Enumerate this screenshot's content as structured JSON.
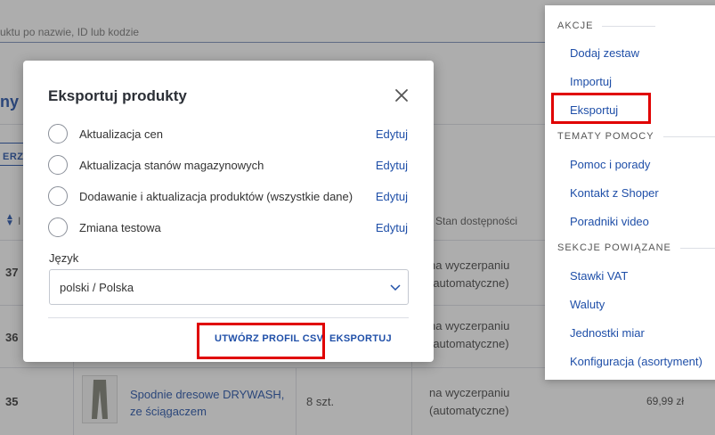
{
  "search": {
    "placeholder": "uktu po nazwie, ID lub kodzie"
  },
  "page": {
    "heading": "ny",
    "filter_label": "ERZ F"
  },
  "table": {
    "header_col_i": "I",
    "header_stock": "Stan dostępności",
    "rows": [
      {
        "id": "37",
        "status_line1": "na wyczerpaniu",
        "status_line2": "(automatyczne)"
      },
      {
        "id": "36",
        "status_line1": "na wyczerpaniu",
        "status_line2": "(automatyczne)"
      },
      {
        "id": "35",
        "name_line1": "Spodnie dresowe DRYWASH,",
        "name_line2": "ze ściągaczem",
        "qty": "8 szt.",
        "status_line1": "na wyczerpaniu",
        "status_line2": "(automatyczne)",
        "price": "69,99 zł"
      }
    ]
  },
  "actions_panel": {
    "section_actions": "AKCJE",
    "items_actions": [
      "Dodaj zestaw",
      "Importuj",
      "Eksportuj"
    ],
    "section_help": "TEMATY POMOCY",
    "items_help": [
      "Pomoc i porady",
      "Kontakt z Shoper",
      "Poradniki video"
    ],
    "section_related": "SEKCJE POWIĄZANE",
    "items_related": [
      "Stawki VAT",
      "Waluty",
      "Jednostki miar",
      "Konfiguracja (asortyment)"
    ]
  },
  "modal": {
    "title": "Eksportuj produkty",
    "edit_label": "Edytuj",
    "options": [
      "Aktualizacja cen",
      "Aktualizacja stanów magazynowych",
      "Dodawanie i aktualizacja produktów (wszystkie dane)",
      "Zmiana testowa"
    ],
    "language_label": "Język",
    "language_value": "polski / Polska",
    "create_csv_button": "UTWÓRZ PROFIL CSV",
    "export_button": "EKSPORTUJ"
  },
  "colors": {
    "accent": "#1f4fa8",
    "highlight": "#e00000",
    "overlay": "rgba(60,60,60,0.42)"
  },
  "icons": {
    "close": "close-icon",
    "chevron": "chevron-down-icon",
    "sort": "sort-icon"
  }
}
